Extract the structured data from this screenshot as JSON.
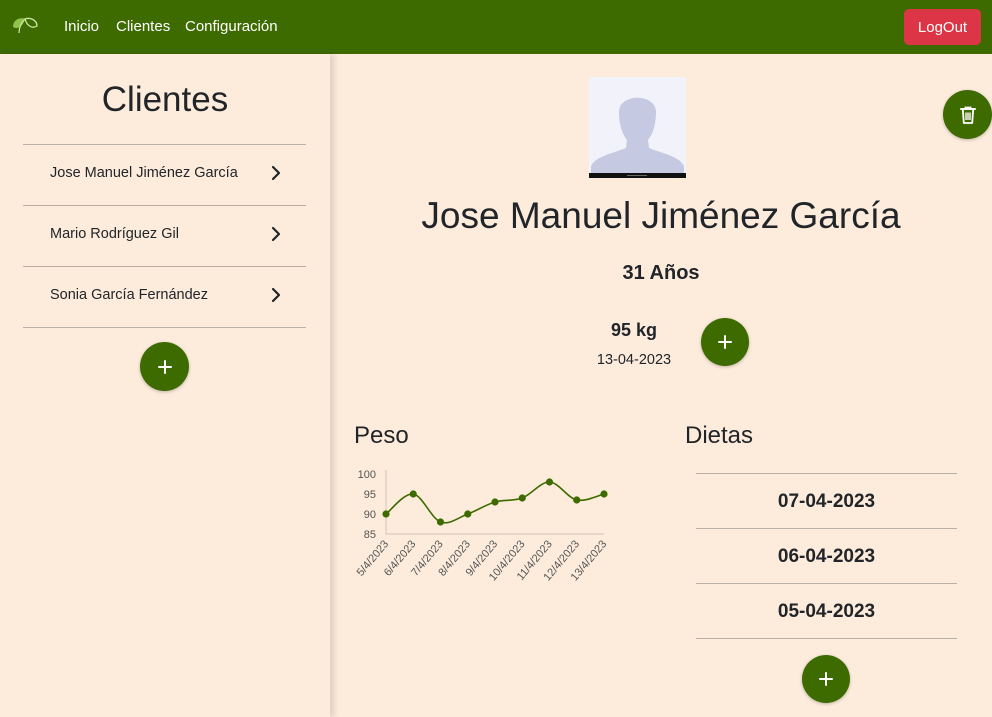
{
  "navbar": {
    "links": [
      "Inicio",
      "Clientes",
      "Configuración"
    ],
    "logout_label": "LogOut",
    "brand_color": "#3d6b00",
    "logout_color": "#dc3545"
  },
  "sidebar": {
    "title": "Clientes",
    "clients": [
      {
        "name": "Jose Manuel Jiménez García"
      },
      {
        "name": "Mario Rodríguez Gil"
      },
      {
        "name": "Sonia García Fernández"
      }
    ],
    "add_icon": "plus-icon"
  },
  "client": {
    "name": "Jose Manuel Jiménez García",
    "age": "31 Años",
    "weight": "95 kg",
    "weight_date": "13-04-2023",
    "avatar_icon": "person-silhouette-icon",
    "delete_icon": "trash-icon"
  },
  "weight_section": {
    "title": "Peso"
  },
  "diets": {
    "title": "Dietas",
    "items": [
      "07-04-2023",
      "06-04-2023",
      "05-04-2023"
    ]
  },
  "chart_data": {
    "type": "line",
    "title": "",
    "xlabel": "",
    "ylabel": "",
    "categories": [
      "5/4/2023",
      "6/4/2023",
      "7/4/2023",
      "8/4/2023",
      "9/4/2023",
      "10/4/2023",
      "11/4/2023",
      "12/4/2023",
      "13/4/2023"
    ],
    "series": [
      {
        "values": [
          90,
          95,
          88,
          90,
          93,
          94,
          98,
          93.5,
          95
        ]
      }
    ],
    "yticks": [
      85,
      90,
      95,
      100
    ],
    "ylim": [
      85,
      100
    ],
    "grid": false,
    "color": "#3d6b00"
  }
}
